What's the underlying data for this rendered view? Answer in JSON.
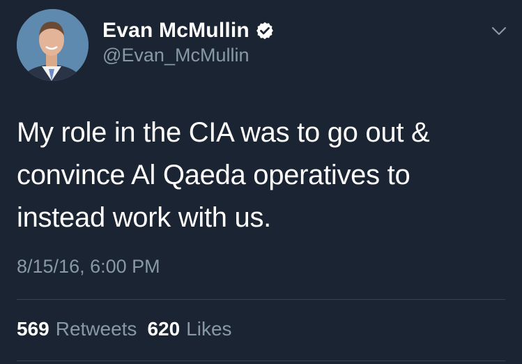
{
  "tweet": {
    "author": {
      "display_name": "Evan McMullin",
      "handle": "@Evan_McMullin",
      "verified": true,
      "avatar_icon": "profile-photo"
    },
    "text": "My role in the CIA was to go out &\nconvince Al Qaeda operatives to\ninstead work with us.",
    "timestamp": "8/15/16, 6:00 PM",
    "stats": {
      "retweets_count": "569",
      "retweets_label": "Retweets",
      "likes_count": "620",
      "likes_label": "Likes"
    },
    "menu_icon": "chevron-down-icon"
  },
  "colors": {
    "background": "#1b2432",
    "primary_text": "#ffffff",
    "secondary_text": "#8899a6",
    "verified_badge": "#ffffff",
    "divider": "#38444d"
  }
}
